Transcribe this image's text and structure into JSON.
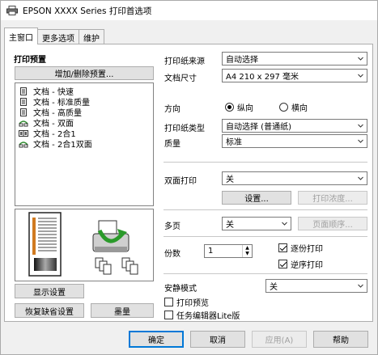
{
  "window": {
    "title": "EPSON XXXX Series 打印首选项"
  },
  "tabs": [
    {
      "label": "主窗口",
      "active": true
    },
    {
      "label": "更多选项",
      "active": false
    },
    {
      "label": "维护",
      "active": false
    }
  ],
  "presets": {
    "heading": "打印预置",
    "add_remove_button": "增加/删除预置...",
    "items": [
      {
        "label": "文档 - 快速",
        "icon": "document-icon"
      },
      {
        "label": "文档 - 标准质量",
        "icon": "document-icon"
      },
      {
        "label": "文档 - 高质量",
        "icon": "document-icon"
      },
      {
        "label": "文档 - 双面",
        "icon": "duplex-icon"
      },
      {
        "label": "文档 - 2合1",
        "icon": "two-up-icon"
      },
      {
        "label": "文档 - 2合1双面",
        "icon": "duplex-icon"
      }
    ]
  },
  "left_buttons": {
    "show_settings": "显示设置",
    "restore_defaults": "恢复缺省设置",
    "ink_levels": "墨量"
  },
  "settings": {
    "paper_source": {
      "label": "打印纸来源",
      "value": "自动选择"
    },
    "document_size": {
      "label": "文档尺寸",
      "value": "A4 210 x 297 毫米"
    },
    "orientation": {
      "label": "方向",
      "portrait": "纵向",
      "landscape": "横向",
      "selected": "portrait"
    },
    "paper_type": {
      "label": "打印纸类型",
      "value": "自动选择 (普通纸)"
    },
    "quality": {
      "label": "质量",
      "value": "标准"
    },
    "duplex": {
      "label": "双面打印",
      "value": "关",
      "settings_button": "设置...",
      "density_button": "打印浓度..."
    },
    "multi_page": {
      "label": "多页",
      "value": "关",
      "page_order_button": "页面顺序..."
    },
    "copies": {
      "label": "份数",
      "value": "1",
      "collate": "逐份打印",
      "collate_checked": true,
      "reverse": "逆序打印",
      "reverse_checked": true
    },
    "quiet_mode": {
      "label": "安静模式",
      "value": "关"
    },
    "print_preview": {
      "label": "打印预览",
      "checked": false
    },
    "job_arranger": {
      "label": "任务编辑器Lite版",
      "checked": false
    }
  },
  "footer": {
    "ok": "确定",
    "cancel": "取消",
    "apply": "应用(A)",
    "help": "帮助"
  }
}
